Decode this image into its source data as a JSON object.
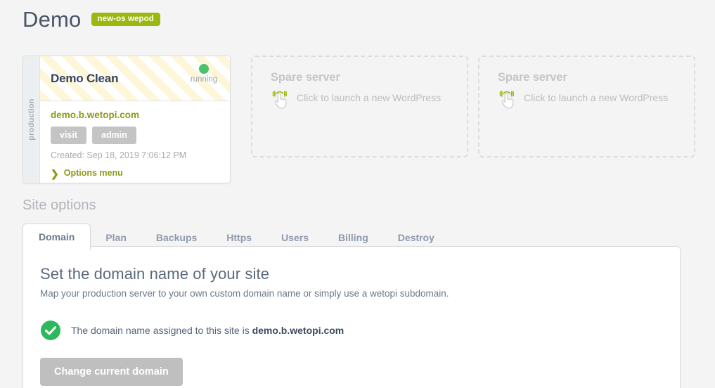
{
  "header": {
    "title": "Demo",
    "badge": "new-os wepod"
  },
  "site_card": {
    "env_label": "production",
    "name": "Demo Clean",
    "status": "running",
    "status_color": "#49c26b",
    "domain": "demo.b.wetopi.com",
    "buttons": [
      {
        "label": "visit",
        "name": "visit-button"
      },
      {
        "label": "admin",
        "name": "admin-button"
      }
    ],
    "created": "Created: Sep 18, 2019 7:06:12 PM",
    "options_menu": "Options menu",
    "accent_color": "#8d9a17"
  },
  "spare_servers": [
    {
      "title": "Spare server",
      "hint": "Click to launch a new WordPress",
      "icon": "click-hand-icon"
    },
    {
      "title": "Spare server",
      "hint": "Click to launch a new WordPress",
      "icon": "click-hand-icon"
    }
  ],
  "site_options": {
    "section_title": "Site options",
    "tabs": [
      {
        "label": "Domain",
        "active": true
      },
      {
        "label": "Plan",
        "active": false
      },
      {
        "label": "Backups",
        "active": false
      },
      {
        "label": "Https",
        "active": false
      },
      {
        "label": "Users",
        "active": false
      },
      {
        "label": "Billing",
        "active": false
      },
      {
        "label": "Destroy",
        "active": false
      }
    ],
    "panel": {
      "heading": "Set the domain name of your site",
      "subtitle": "Map your production server to your own custom domain name or simply use a wetopi subdomain.",
      "assigned_prefix": "The domain name assigned to this site is ",
      "assigned_domain": "demo.b.wetopi.com",
      "success_color": "#2eb85c",
      "change_button": "Change current domain"
    }
  }
}
